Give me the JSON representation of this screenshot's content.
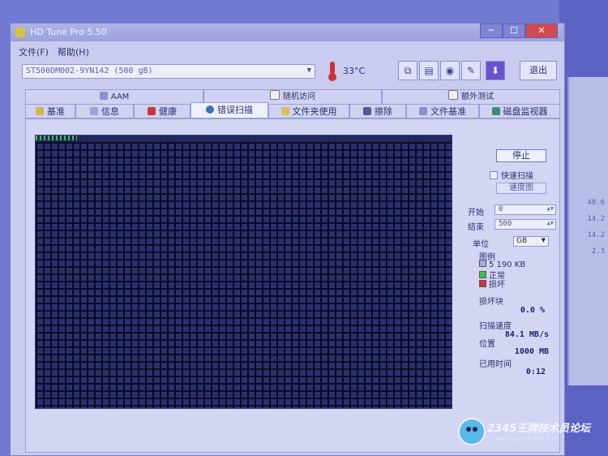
{
  "window": {
    "title": "HD Tune Pro 5.50"
  },
  "window_controls": {
    "minimize": "─",
    "maximize": "☐",
    "close": "✕"
  },
  "menu": [
    "文件(F)",
    "帮助(H)"
  ],
  "toolbar": {
    "drive": "ST500DM002-9YN142 (500 gB)",
    "temperature": "33°C",
    "exit_label": "退出"
  },
  "tabs_row1": [
    {
      "label": "AAM",
      "icon": "speaker-icon"
    },
    {
      "label": "随机访问",
      "icon": "random-access-icon"
    },
    {
      "label": "额外测试",
      "icon": "extra-tests-icon"
    }
  ],
  "tabs_row2": [
    {
      "label": "基准",
      "icon": "benchmark-icon"
    },
    {
      "label": "信息",
      "icon": "info-icon"
    },
    {
      "label": "健康",
      "icon": "health-cross-icon"
    },
    {
      "label": "错误扫描",
      "icon": "magnifier-icon",
      "active": true
    },
    {
      "label": "文件夹使用",
      "icon": "folder-icon"
    },
    {
      "label": "擦除",
      "icon": "trash-icon"
    },
    {
      "label": "文件基准",
      "icon": "file-benchmark-icon"
    },
    {
      "label": "磁盘监视器",
      "icon": "disk-monitor-icon"
    }
  ],
  "scan": {
    "progress_fraction": 0.1,
    "colors": {
      "ok": "#3bbf4a",
      "bad": "#d0303a",
      "grid": "#080a22"
    }
  },
  "side": {
    "stop_label": "停止",
    "quick_scan_label": "快速扫描",
    "speed_map_label": "速度图",
    "start_label": "开始",
    "start_value": "0",
    "end_label": "结束",
    "end_value": "500",
    "unit_label": "单位",
    "unit_value": "GB",
    "legend_title": "图例",
    "block_size": "5 190 KB",
    "ok_label": "正常",
    "damaged_label": "损坏",
    "damaged_blocks_label": "损坏块",
    "damaged_blocks_value": "0.0 %",
    "scan_speed_label": "扫描速度",
    "scan_speed_value": "84.1 MB/s",
    "position_label": "位置",
    "position_value": "1000 MB",
    "elapsed_label": "已用时间",
    "elapsed_value": "0:12"
  },
  "background_values": [
    "48.6",
    "14.2",
    "14.2",
    "2.3"
  ],
  "watermark": {
    "text": "2345王牌技术员论坛",
    "url": "wangpai.2345.cn"
  }
}
